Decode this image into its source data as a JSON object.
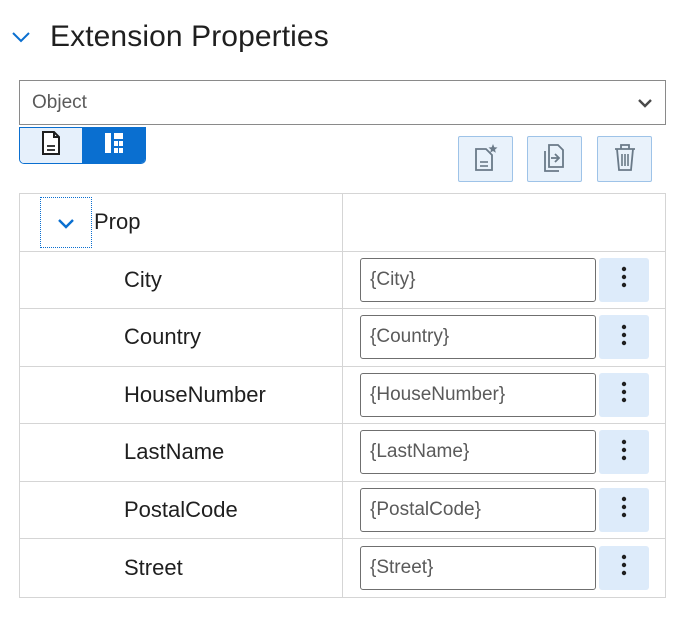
{
  "section": {
    "title": "Extension Properties",
    "chevron_icon": "chevron-down-icon"
  },
  "type_select": {
    "value": "Object",
    "chevron_icon": "chevron-down-icon"
  },
  "view_toggle": {
    "options": [
      {
        "icon": "document-view-icon",
        "active": false
      },
      {
        "icon": "tree-view-icon",
        "active": true
      }
    ]
  },
  "toolbar": {
    "buttons": [
      {
        "icon": "new-property-icon"
      },
      {
        "icon": "import-icon"
      },
      {
        "icon": "delete-icon"
      }
    ]
  },
  "properties": {
    "group": {
      "name": "Prop",
      "expanded": true
    },
    "rows": [
      {
        "name": "City",
        "value": "{City}"
      },
      {
        "name": "Country",
        "value": "{Country}"
      },
      {
        "name": "HouseNumber",
        "value": "{HouseNumber}"
      },
      {
        "name": "LastName",
        "value": "{LastName}"
      },
      {
        "name": "PostalCode",
        "value": "{PostalCode}"
      },
      {
        "name": "Street",
        "value": "{Street}"
      }
    ]
  },
  "colors": {
    "accent": "#0a6fd0",
    "button_bg": "#e9f2fb",
    "menu_button_bg": "#ddebfa",
    "border": "#d5d5d5"
  }
}
